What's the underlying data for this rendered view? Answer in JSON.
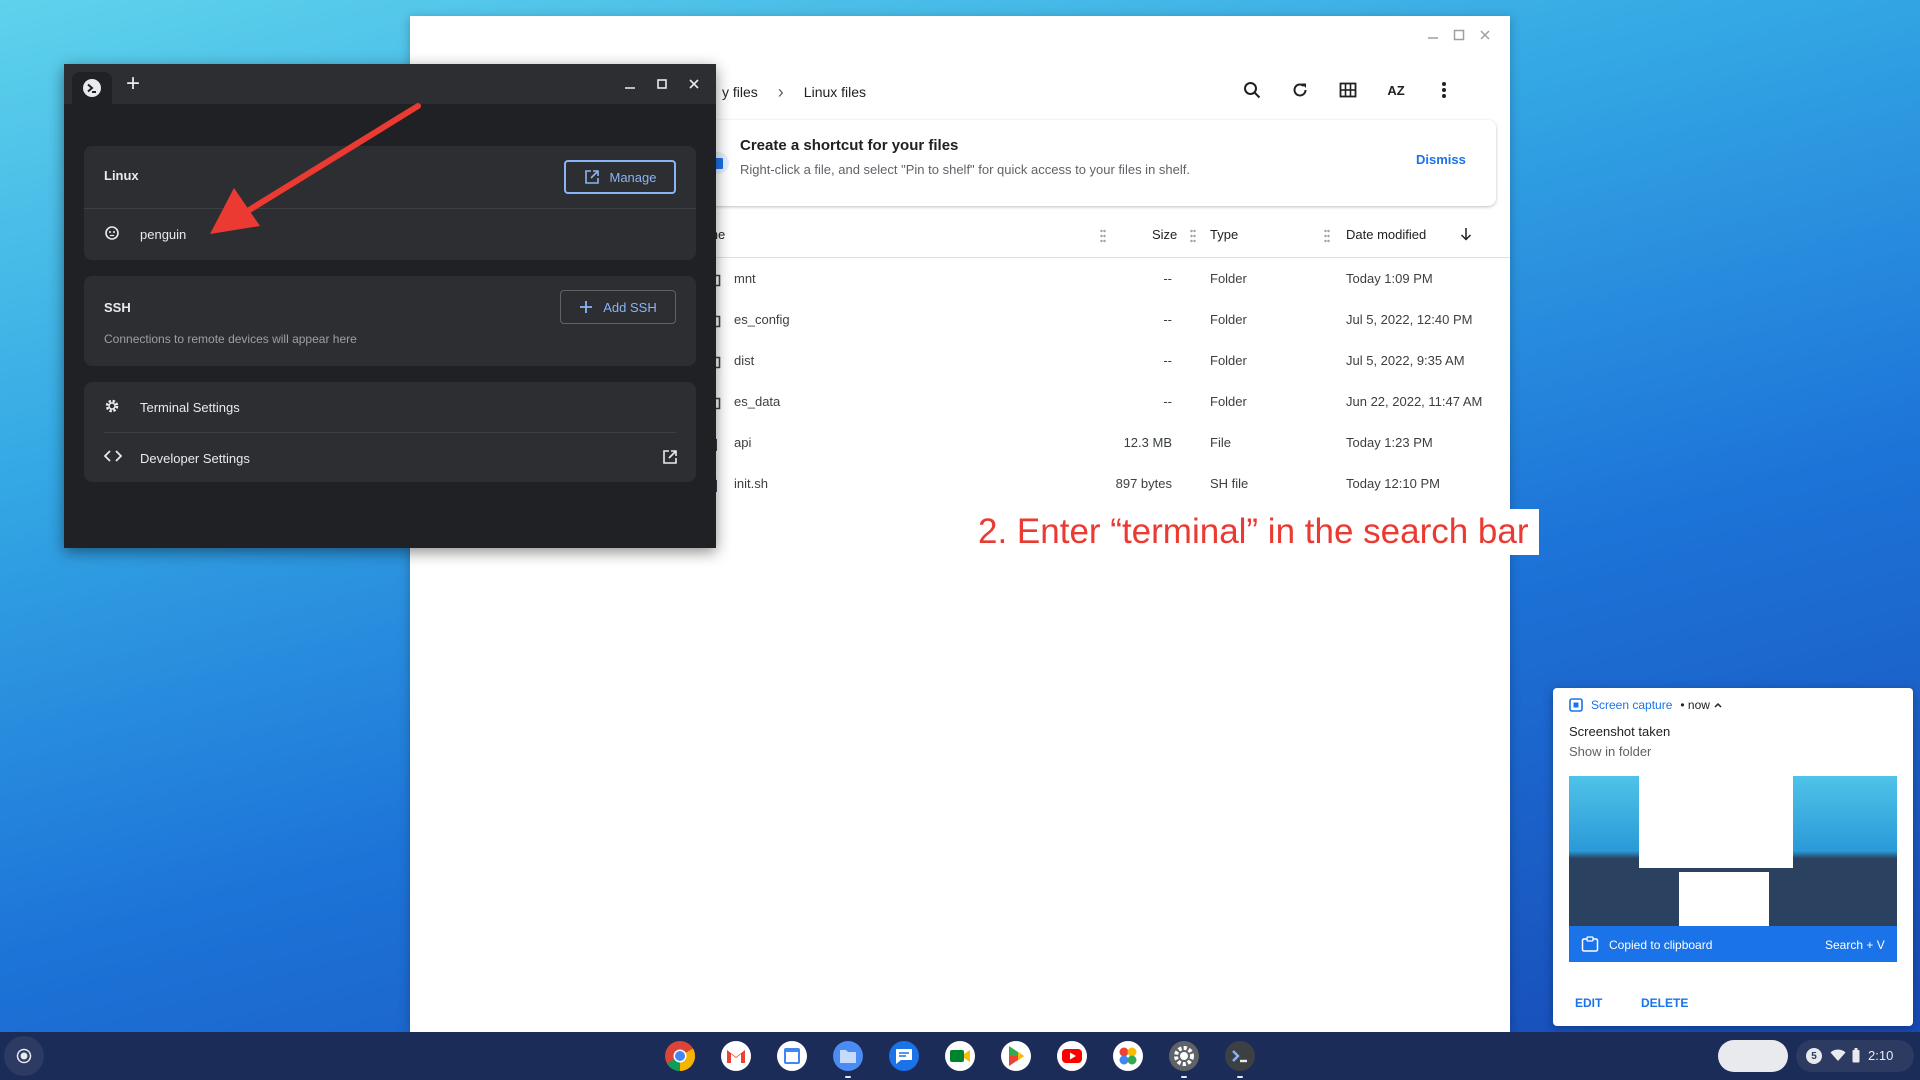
{
  "files": {
    "breadcrumb": {
      "parent": "y files",
      "separator": "›",
      "current": "Linux files"
    },
    "toolbar": {
      "search": "search-icon",
      "refresh": "refresh-icon",
      "grid": "grid-view-icon",
      "sort": "AZ",
      "more": "more-vert-icon"
    },
    "banner": {
      "title": "Create a shortcut for your files",
      "subtitle": "Right-click a file, and select \"Pin to shelf\" for quick access to your files in shelf.",
      "dismiss": "Dismiss"
    },
    "columns": {
      "name": "ame",
      "size": "Size",
      "type": "Type",
      "date": "Date modified"
    },
    "rows": [
      {
        "name": "mnt",
        "size": "--",
        "type": "Folder",
        "date": "Today 1:09 PM",
        "kind": "folder"
      },
      {
        "name": "es_config",
        "size": "--",
        "type": "Folder",
        "date": "Jul 5, 2022, 12:40 PM",
        "kind": "folder"
      },
      {
        "name": "dist",
        "size": "--",
        "type": "Folder",
        "date": "Jul 5, 2022, 9:35 AM",
        "kind": "folder"
      },
      {
        "name": "es_data",
        "size": "--",
        "type": "Folder",
        "date": "Jun 22, 2022, 11:47 AM",
        "kind": "folder"
      },
      {
        "name": "api",
        "size": "12.3 MB",
        "type": "File",
        "date": "Today 1:23 PM",
        "kind": "file"
      },
      {
        "name": "init.sh",
        "size": "897 bytes",
        "type": "SH file",
        "date": "Today 12:10 PM",
        "kind": "file"
      }
    ]
  },
  "annotation": "2. Enter “terminal” in the search bar",
  "terminal": {
    "new_tab": "+",
    "linux": {
      "label": "Linux",
      "manage": "Manage",
      "container": "penguin"
    },
    "ssh": {
      "label": "SSH",
      "add": "Add SSH",
      "empty": "Connections to remote devices will appear here"
    },
    "settings": {
      "terminal": "Terminal Settings",
      "developer": "Developer Settings"
    }
  },
  "notification": {
    "source": "Screen capture",
    "time": "• now",
    "title": "Screenshot taken",
    "subtitle": "Show in folder",
    "clipboard": "Copied to clipboard",
    "shortcut": "Search + V",
    "actions": {
      "edit": "EDIT",
      "delete": "DELETE"
    }
  },
  "shelf": {
    "apps": [
      "chrome-icon",
      "gmail-icon",
      "calendar-icon",
      "files-icon",
      "messages-icon",
      "meet-icon",
      "play-store-icon",
      "youtube-icon",
      "photos-icon",
      "settings-icon",
      "terminal-icon"
    ],
    "status": {
      "badge": "5",
      "time": "2:10"
    }
  },
  "colors": {
    "accent": "#1a73e8",
    "annotation": "#ea3a32",
    "terminal_bg": "#202124",
    "shelf": "#1c2c58"
  }
}
